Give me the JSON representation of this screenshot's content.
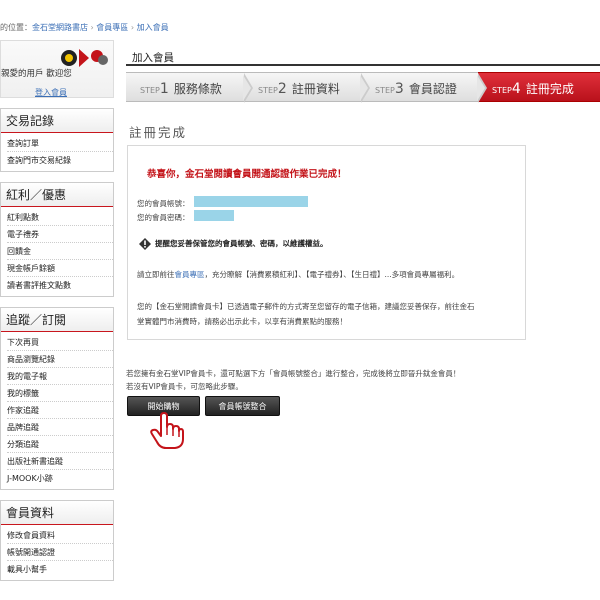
{
  "breadcrumb": {
    "prefix": "的位置：",
    "items": [
      "金石堂網路書店",
      "會員專區",
      "加入會員"
    ],
    "sep": "›"
  },
  "user_box": {
    "greeting": "親愛的用戶 歡迎您",
    "logout": "登入會員"
  },
  "sidebar": {
    "sections": [
      {
        "title": "交易記錄",
        "items": [
          "查詢訂單",
          "查詢門市交易紀錄"
        ]
      },
      {
        "title": "紅利／優惠",
        "items": [
          "紅利點數",
          "電子禮券",
          "回饋金",
          "現金帳戶餘額",
          "讀者書評推文點數"
        ]
      },
      {
        "title": "追蹤／訂閱",
        "items": [
          "下次再買",
          "商品瀏覽紀錄",
          "我的電子報",
          "我的標籤",
          "作家追蹤",
          "品牌追蹤",
          "分類追蹤",
          "出版社新書追蹤",
          "J-MOOK小跡"
        ]
      },
      {
        "title": "會員資料",
        "items": [
          "修改會員資料",
          "帳號開通認證",
          "載具小幫手"
        ]
      }
    ]
  },
  "main": {
    "title": "加入會員",
    "steps": [
      {
        "small": "STEP",
        "num": "1",
        "label": "服務條款"
      },
      {
        "small": "STEP",
        "num": "2",
        "label": "註冊資料"
      },
      {
        "small": "STEP",
        "num": "3",
        "label": "會員認證"
      },
      {
        "small": "STEP",
        "num": "4",
        "label": "註冊完成"
      }
    ],
    "done_title": "註冊完成",
    "congrats": "恭喜你，金石堂閱讀會員開通認證作業已完成！",
    "account_label": "您的會員帳號：",
    "password_label": "您的會員密碼：",
    "warning": "提醒您妥善保管您的會員帳號、密碼，以維護權益。",
    "line1_prefix": "請立即前往",
    "line1_link": "會員專區",
    "line1_suffix": "，充分瞭解【消費累積紅利】、【電子禮券】、【生日禮】...多項會員專屬福利。",
    "line2a": "您的【金石堂閱讀會員卡】已透過電子郵件的方式寄至您留存的電子信箱，建議您妥善保存，前往金石",
    "line2b": "堂實體門市消費時，請務必出示此卡，以享有消費累點的服務！",
    "note1": "若您擁有金石堂VIP會員卡，還可點選下方「會員帳號整合」進行整合，完成後將立即晉升鈦金會員！",
    "note2": "若沒有VIP會員卡，可忽略此步驟。",
    "btn_shop": "開始購物",
    "btn_merge": "會員帳號整合"
  },
  "colors": {
    "accent_red": "#c4141a",
    "mask_blue": "#9ad4e8",
    "link_blue": "#3b6fb6"
  }
}
